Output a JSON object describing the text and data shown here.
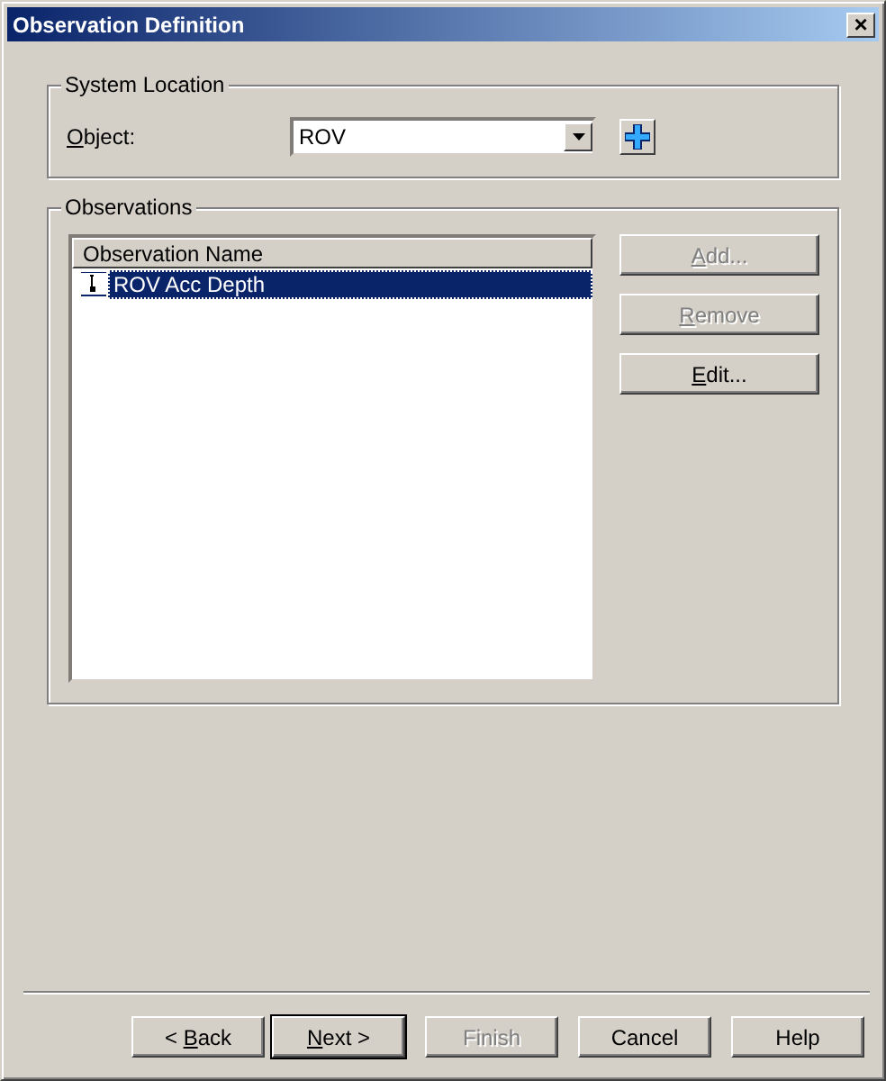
{
  "window": {
    "title": "Observation Definition",
    "close": "×"
  },
  "system_location": {
    "title": "System Location",
    "object_label": {
      "key": "O",
      "post": "bject:"
    },
    "object_value": "ROV"
  },
  "observations": {
    "title": "Observations",
    "column": "Observation Name",
    "rows": [
      {
        "name": "ROV Acc Depth",
        "selected": true
      }
    ],
    "buttons": [
      {
        "key": "A",
        "post": "dd...",
        "disabled": true
      },
      {
        "key": "R",
        "post": "emove",
        "disabled": true
      },
      {
        "key": "E",
        "post": "dit...",
        "disabled": false
      }
    ]
  },
  "footer_buttons": [
    {
      "pre": "< ",
      "key": "B",
      "post": "ack",
      "disabled": false,
      "default": false
    },
    {
      "key": "N",
      "post": "ext >",
      "disabled": false,
      "default": true
    },
    {
      "pre": "Finish",
      "disabled": true,
      "default": false
    },
    {
      "pre": "Cancel",
      "disabled": false,
      "default": false
    },
    {
      "pre": "Help",
      "disabled": false,
      "default": false
    }
  ]
}
